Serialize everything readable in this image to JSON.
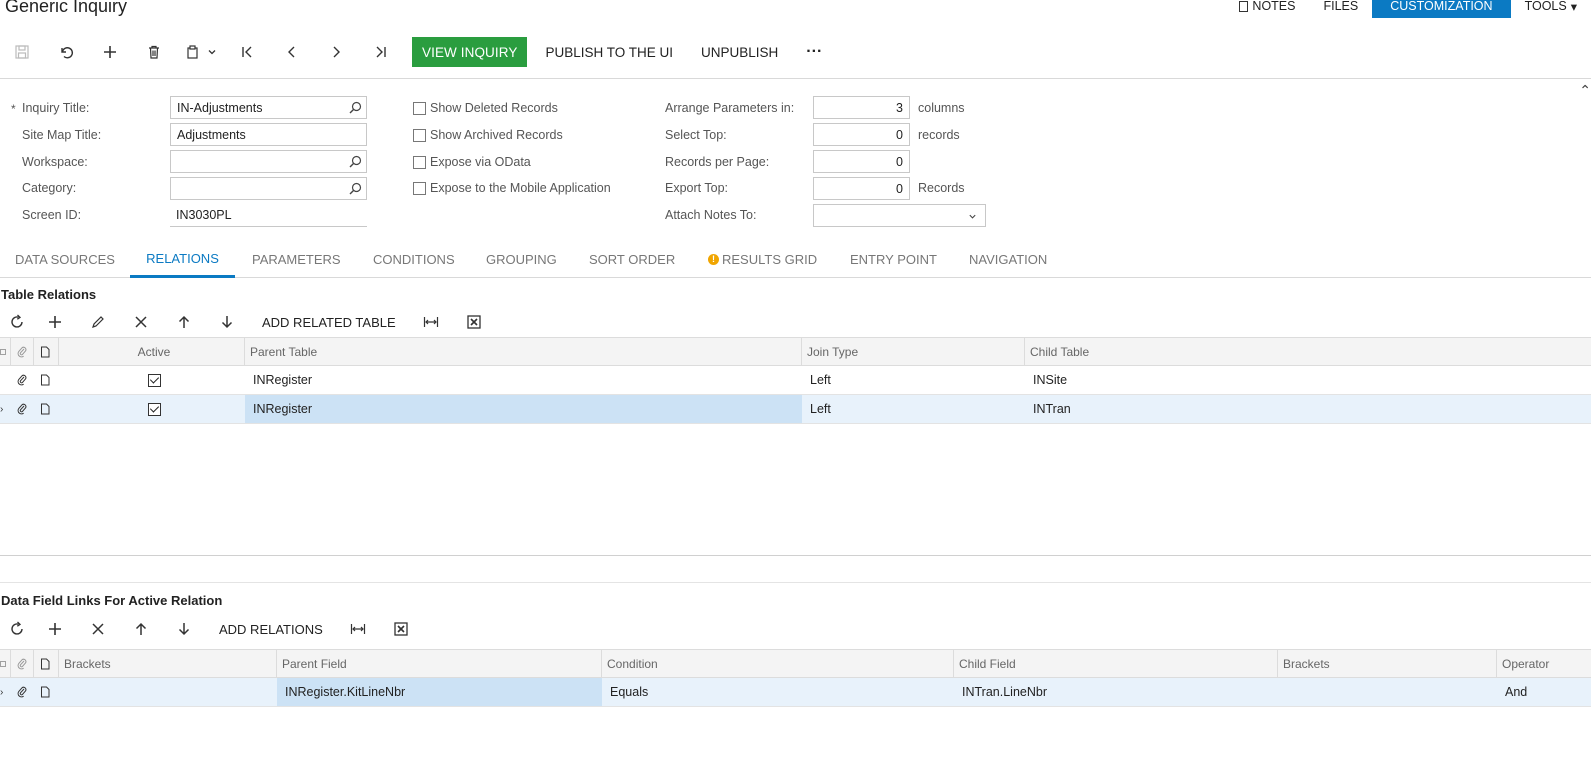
{
  "header": {
    "title": "Generic Inquiry",
    "notes": "NOTES",
    "files": "FILES",
    "customization": "CUSTOMIZATION",
    "tools": "TOOLS"
  },
  "toolbar": {
    "view_inquiry": "VIEW INQUIRY",
    "publish": "PUBLISH TO THE UI",
    "unpublish": "UNPUBLISH",
    "more": "···"
  },
  "form": {
    "inquiry_title_label": "Inquiry Title:",
    "inquiry_title_value": "IN-Adjustments",
    "site_map_title_label": "Site Map Title:",
    "site_map_title_value": "Adjustments",
    "workspace_label": "Workspace:",
    "workspace_value": "",
    "category_label": "Category:",
    "category_value": "",
    "screen_id_label": "Screen ID:",
    "screen_id_value": "IN3030PL",
    "show_deleted": "Show Deleted Records",
    "show_archived": "Show Archived Records",
    "expose_odata": "Expose via OData",
    "expose_mobile": "Expose to the Mobile Application",
    "arrange_label": "Arrange Parameters in:",
    "arrange_value": "3",
    "arrange_suffix": "columns",
    "select_top_label": "Select Top:",
    "select_top_value": "0",
    "select_top_suffix": "records",
    "records_per_page_label": "Records per Page:",
    "records_per_page_value": "0",
    "export_top_label": "Export Top:",
    "export_top_value": "0",
    "export_top_suffix": "Records",
    "attach_notes_label": "Attach Notes To:",
    "attach_notes_value": ""
  },
  "tabs": [
    {
      "label": "DATA SOURCES"
    },
    {
      "label": "RELATIONS"
    },
    {
      "label": "PARAMETERS"
    },
    {
      "label": "CONDITIONS"
    },
    {
      "label": "GROUPING"
    },
    {
      "label": "SORT ORDER"
    },
    {
      "label": "RESULTS GRID"
    },
    {
      "label": "ENTRY POINT"
    },
    {
      "label": "NAVIGATION"
    }
  ],
  "relations": {
    "title": "Table Relations",
    "add_related": "ADD RELATED TABLE",
    "columns": [
      "Active",
      "Parent Table",
      "Join Type",
      "Child Table"
    ],
    "rows": [
      {
        "active": true,
        "parent": "INRegister",
        "join": "Left",
        "child": "INSite"
      },
      {
        "active": true,
        "parent": "INRegister",
        "join": "Left",
        "child": "INTran"
      }
    ]
  },
  "links": {
    "title": "Data Field Links For Active Relation",
    "add_relations": "ADD RELATIONS",
    "columns": [
      "Brackets",
      "Parent Field",
      "Condition",
      "Child Field",
      "Brackets",
      "Operator"
    ],
    "rows": [
      {
        "brackets": "",
        "parent_field": "INRegister.KitLineNbr",
        "condition": "Equals",
        "child_field": "INTran.LineNbr",
        "brackets2": "",
        "operator": "And"
      }
    ]
  }
}
